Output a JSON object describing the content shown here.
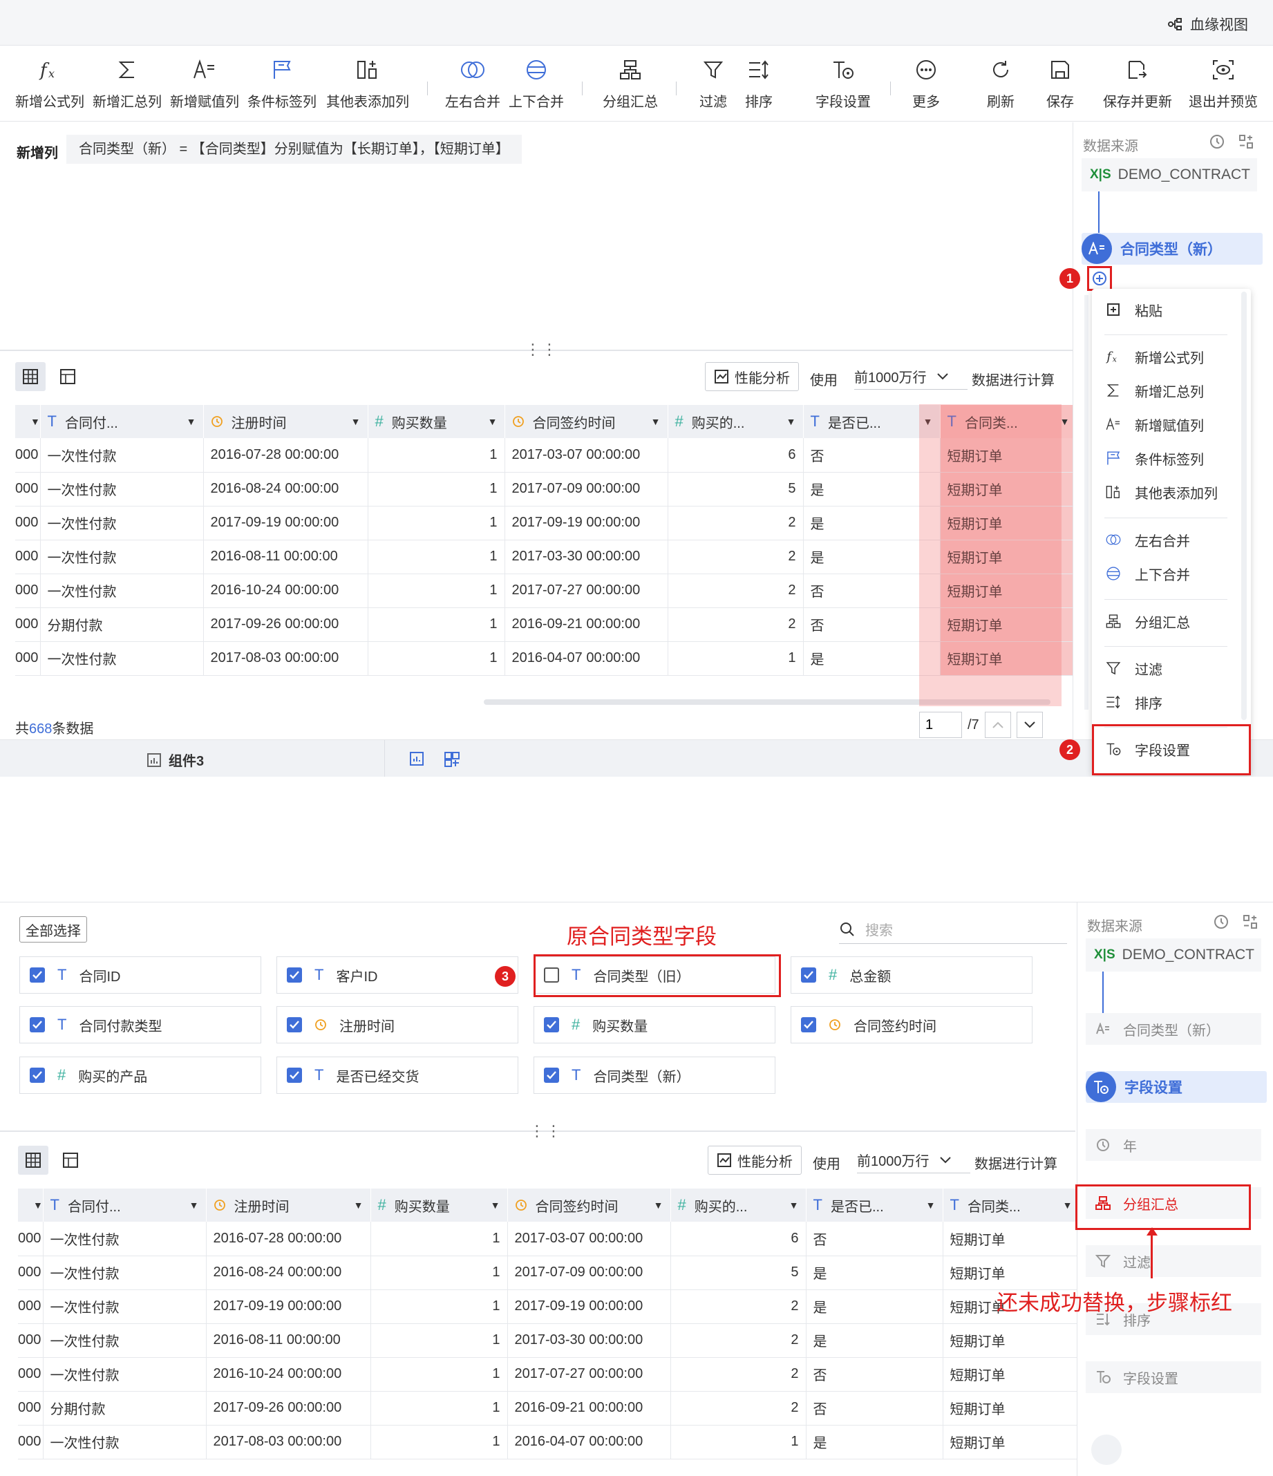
{
  "header": {
    "lineage_label": "血缘视图"
  },
  "toolbar": {
    "items": [
      {
        "label": "新增公式列",
        "icon": "formula-icon"
      },
      {
        "label": "新增汇总列",
        "icon": "sigma-icon"
      },
      {
        "label": "新增赋值列",
        "icon": "assign-icon"
      },
      {
        "label": "条件标签列",
        "icon": "flag-icon"
      },
      {
        "label": "其他表添加列",
        "icon": "add-column-icon"
      },
      {
        "label": "左右合并",
        "icon": "merge-lr-icon"
      },
      {
        "label": "上下合并",
        "icon": "merge-tb-icon"
      },
      {
        "label": "分组汇总",
        "icon": "group-icon"
      },
      {
        "label": "过滤",
        "icon": "filter-icon"
      },
      {
        "label": "排序",
        "icon": "sort-icon"
      },
      {
        "label": "字段设置",
        "icon": "field-settings-icon"
      },
      {
        "label": "更多",
        "icon": "more-icon"
      },
      {
        "label": "刷新",
        "icon": "refresh-icon"
      },
      {
        "label": "保存",
        "icon": "save-icon"
      },
      {
        "label": "保存并更新",
        "icon": "save-update-icon"
      },
      {
        "label": "退出并预览",
        "icon": "exit-preview-icon"
      }
    ]
  },
  "formula": {
    "label": "新增列",
    "expression": "合同类型（新） = 【合同类型】分别赋值为【长期订单】，【短期订单】"
  },
  "table_controls": {
    "perf_label": "性能分析",
    "use_label": "使用",
    "rows_option": "前1000万行",
    "calc_label": "数据进行计算"
  },
  "table": {
    "columns": [
      {
        "name": "",
        "type": "none"
      },
      {
        "name": "合同付...",
        "type": "T"
      },
      {
        "name": "注册时间",
        "type": "clock"
      },
      {
        "name": "购买数量",
        "type": "#"
      },
      {
        "name": "合同签约时间",
        "type": "clock"
      },
      {
        "name": "购买的...",
        "type": "#"
      },
      {
        "name": "是否已...",
        "type": "T"
      },
      {
        "name": "合同类...",
        "type": "T"
      }
    ],
    "rows": [
      [
        "000",
        "一次性付款",
        "2016-07-28 00:00:00",
        "1",
        "2017-03-07 00:00:00",
        "6",
        "否",
        "短期订单"
      ],
      [
        "000",
        "一次性付款",
        "2016-08-24 00:00:00",
        "1",
        "2017-07-09 00:00:00",
        "5",
        "是",
        "短期订单"
      ],
      [
        "000",
        "一次性付款",
        "2017-09-19 00:00:00",
        "1",
        "2017-09-19 00:00:00",
        "2",
        "是",
        "短期订单"
      ],
      [
        "000",
        "一次性付款",
        "2016-08-11 00:00:00",
        "1",
        "2017-03-30 00:00:00",
        "2",
        "是",
        "短期订单"
      ],
      [
        "000",
        "一次性付款",
        "2016-10-24 00:00:00",
        "1",
        "2017-07-27 00:00:00",
        "2",
        "否",
        "短期订单"
      ],
      [
        "000",
        "分期付款",
        "2017-09-26 00:00:00",
        "1",
        "2016-09-21 00:00:00",
        "2",
        "否",
        "短期订单"
      ],
      [
        "000",
        "一次性付款",
        "2017-08-03 00:00:00",
        "1",
        "2016-04-07 00:00:00",
        "1",
        "是",
        "短期订单"
      ]
    ]
  },
  "footer": {
    "total_prefix": "共",
    "total_count": "668",
    "total_suffix": "条数据",
    "page_value": "1",
    "page_total": "/7"
  },
  "bottombar": {
    "component_label": "组件3"
  },
  "right_panel": {
    "title": "数据来源",
    "source": "DEMO_CONTRACT",
    "step_new_col": "合同类型（新）",
    "step_field_settings": "字段设置",
    "step_year": "年",
    "step_group": "分组汇总",
    "step_filter": "过滤",
    "step_sort": "排序",
    "step_field_settings2": "字段设置"
  },
  "menu": {
    "items": [
      {
        "label": "粘贴",
        "icon": "paste-icon"
      },
      {
        "label": "新增公式列",
        "icon": "formula-icon"
      },
      {
        "label": "新增汇总列",
        "icon": "sigma-icon"
      },
      {
        "label": "新增赋值列",
        "icon": "assign-icon"
      },
      {
        "label": "条件标签列",
        "icon": "flag-icon"
      },
      {
        "label": "其他表添加列",
        "icon": "add-column-icon"
      },
      {
        "label": "左右合并",
        "icon": "merge-lr-icon"
      },
      {
        "label": "上下合并",
        "icon": "merge-tb-icon"
      },
      {
        "label": "分组汇总",
        "icon": "group-icon"
      },
      {
        "label": "过滤",
        "icon": "filter-icon"
      },
      {
        "label": "排序",
        "icon": "sort-icon"
      },
      {
        "label": "字段设置",
        "icon": "field-settings-icon"
      }
    ]
  },
  "badges": {
    "b1": "1",
    "b2": "2",
    "b3": "3"
  },
  "annotations": {
    "original_field": "原合同类型字段",
    "not_replaced": "还未成功替换，步骤标红"
  },
  "field_settings": {
    "select_all": "全部选择",
    "search_placeholder": "搜索",
    "fields": [
      {
        "label": "合同ID",
        "type": "T",
        "checked": true
      },
      {
        "label": "客户ID",
        "type": "T",
        "checked": true
      },
      {
        "label": "合同类型（旧）",
        "type": "T",
        "checked": false
      },
      {
        "label": "总金额",
        "type": "#",
        "checked": true
      },
      {
        "label": "合同付款类型",
        "type": "T",
        "checked": true
      },
      {
        "label": "注册时间",
        "type": "clock",
        "checked": true
      },
      {
        "label": "购买数量",
        "type": "#",
        "checked": true
      },
      {
        "label": "合同签约时间",
        "type": "clock",
        "checked": true
      },
      {
        "label": "购买的产品",
        "type": "#",
        "checked": true
      },
      {
        "label": "是否已经交货",
        "type": "T",
        "checked": true
      },
      {
        "label": "合同类型（新）",
        "type": "T",
        "checked": true
      }
    ]
  }
}
